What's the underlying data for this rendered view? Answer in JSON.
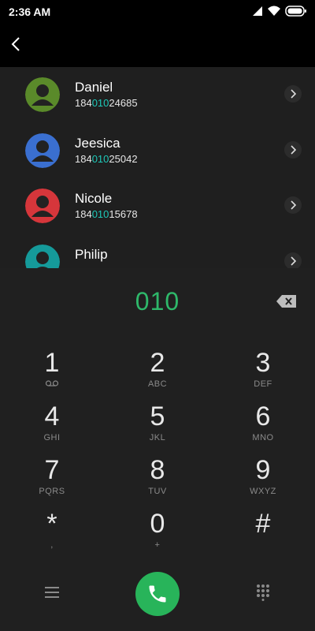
{
  "status": {
    "time": "2:36 AM"
  },
  "contacts": [
    {
      "name": "Daniel",
      "number_prefix": "184",
      "number_match": "010",
      "number_suffix": "24685",
      "color": "#5a8a2a"
    },
    {
      "name": "Jeesica",
      "number_prefix": "184",
      "number_match": "010",
      "number_suffix": "25042",
      "color": "#3a6fd0"
    },
    {
      "name": "Nicole",
      "number_prefix": "184",
      "number_match": "010",
      "number_suffix": "15678",
      "color": "#d6363b"
    },
    {
      "name": "Philip",
      "number_prefix": "",
      "number_match": "",
      "number_suffix": "",
      "color": "#159a9a"
    }
  ],
  "dial": {
    "entered": "010"
  },
  "keys": [
    {
      "num": "1",
      "sub": ""
    },
    {
      "num": "2",
      "sub": "ABC"
    },
    {
      "num": "3",
      "sub": "DEF"
    },
    {
      "num": "4",
      "sub": "GHI"
    },
    {
      "num": "5",
      "sub": "JKL"
    },
    {
      "num": "6",
      "sub": "MNO"
    },
    {
      "num": "7",
      "sub": "PQRS"
    },
    {
      "num": "8",
      "sub": "TUV"
    },
    {
      "num": "9",
      "sub": "WXYZ"
    },
    {
      "num": "*",
      "sub": ","
    },
    {
      "num": "0",
      "sub": "+"
    },
    {
      "num": "#",
      "sub": ""
    }
  ],
  "icons": {
    "back": "chevron-left-icon",
    "backspace": "backspace-icon",
    "menu": "menu-icon",
    "call": "phone-icon",
    "keypad": "keypad-icon",
    "voicemail": "voicemail-icon"
  },
  "colors": {
    "accent": "#2eb86a",
    "match": "#1ec8b8",
    "call": "#28b45a"
  }
}
